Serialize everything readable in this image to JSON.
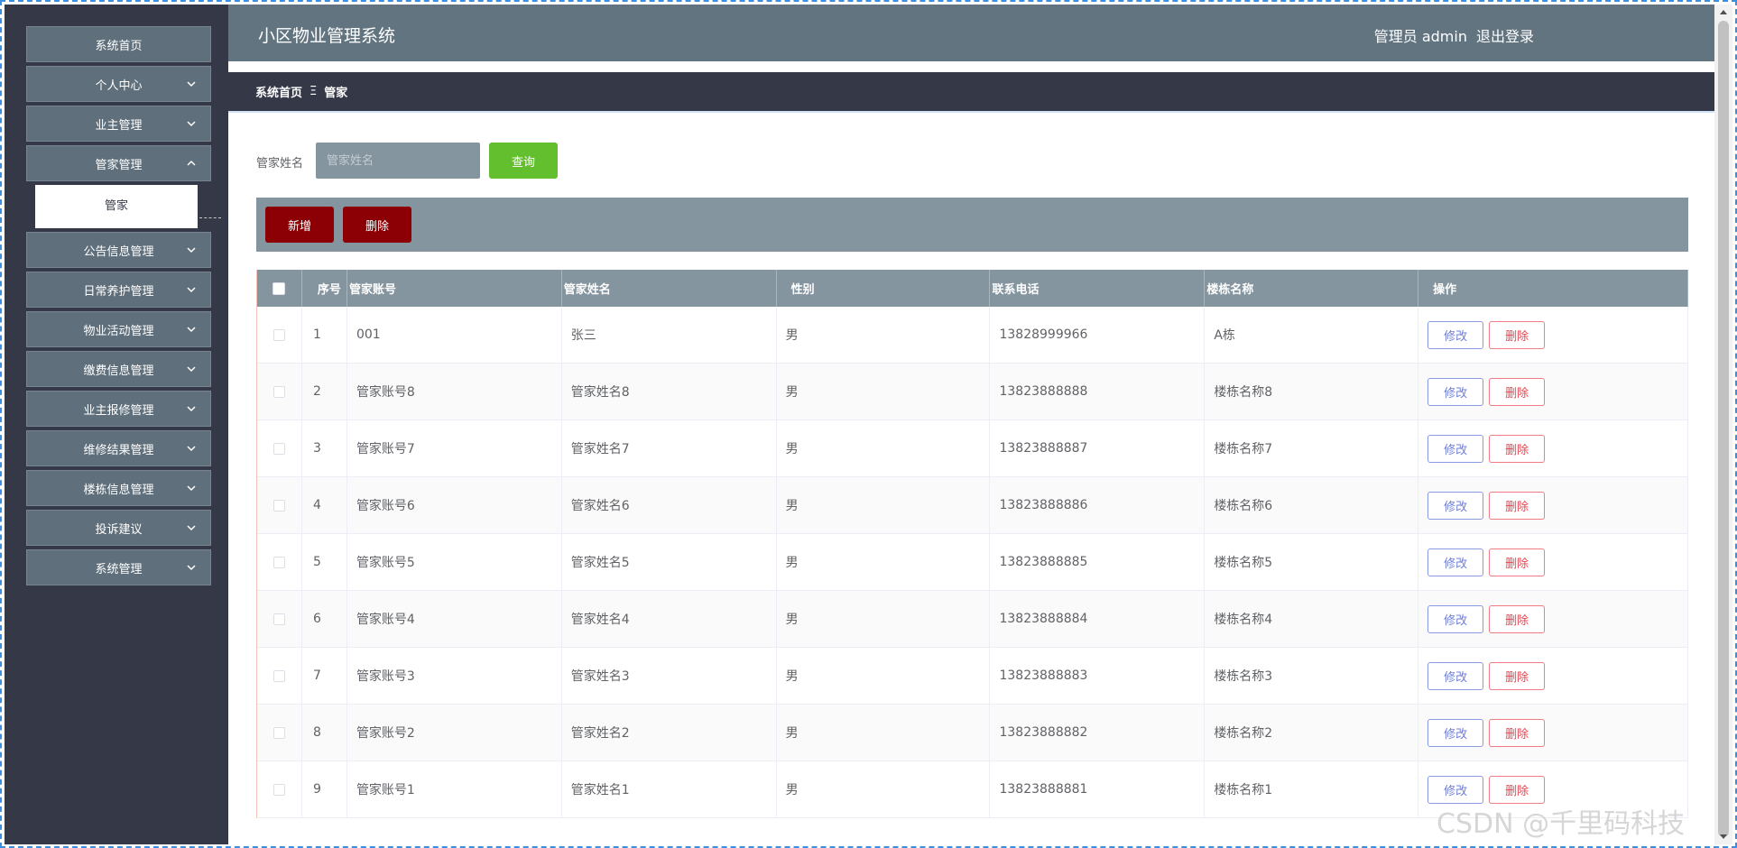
{
  "app": {
    "title": "小区物业管理系统"
  },
  "header": {
    "user": "管理员 admin",
    "logout": "退出登录"
  },
  "sidebar": {
    "items": [
      {
        "label": "系统首页",
        "chevron": "none"
      },
      {
        "label": "个人中心",
        "chevron": "down"
      },
      {
        "label": "业主管理",
        "chevron": "down"
      },
      {
        "label": "管家管理",
        "chevron": "up"
      },
      {
        "label": "公告信息管理",
        "chevron": "down"
      },
      {
        "label": "日常养护管理",
        "chevron": "down"
      },
      {
        "label": "物业活动管理",
        "chevron": "down"
      },
      {
        "label": "缴费信息管理",
        "chevron": "down"
      },
      {
        "label": "业主报修管理",
        "chevron": "down"
      },
      {
        "label": "维修结果管理",
        "chevron": "down"
      },
      {
        "label": "楼栋信息管理",
        "chevron": "down"
      },
      {
        "label": "投诉建议",
        "chevron": "down"
      },
      {
        "label": "系统管理",
        "chevron": "down"
      }
    ],
    "submenu": {
      "label": "管家"
    }
  },
  "breadcrumb": {
    "home": "系统首页",
    "separator": "Ξ",
    "current": "管家"
  },
  "search": {
    "label": "管家姓名",
    "placeholder": "管家姓名",
    "value": "",
    "button": "查询"
  },
  "actions": {
    "add": "新增",
    "delete": "删除"
  },
  "table": {
    "headers": {
      "no": "序号",
      "account": "管家账号",
      "name": "管家姓名",
      "sex": "性别",
      "phone": "联系电话",
      "building": "楼栋名称",
      "op": "操作"
    },
    "edit_label": "修改",
    "delete_label": "删除",
    "rows": [
      {
        "no": "1",
        "account": "001",
        "name": "张三",
        "sex": "男",
        "phone": "13828999966",
        "building": "A栋"
      },
      {
        "no": "2",
        "account": "管家账号8",
        "name": "管家姓名8",
        "sex": "男",
        "phone": "13823888888",
        "building": "楼栋名称8"
      },
      {
        "no": "3",
        "account": "管家账号7",
        "name": "管家姓名7",
        "sex": "男",
        "phone": "13823888887",
        "building": "楼栋名称7"
      },
      {
        "no": "4",
        "account": "管家账号6",
        "name": "管家姓名6",
        "sex": "男",
        "phone": "13823888886",
        "building": "楼栋名称6"
      },
      {
        "no": "5",
        "account": "管家账号5",
        "name": "管家姓名5",
        "sex": "男",
        "phone": "13823888885",
        "building": "楼栋名称5"
      },
      {
        "no": "6",
        "account": "管家账号4",
        "name": "管家姓名4",
        "sex": "男",
        "phone": "13823888884",
        "building": "楼栋名称4"
      },
      {
        "no": "7",
        "account": "管家账号3",
        "name": "管家姓名3",
        "sex": "男",
        "phone": "13823888883",
        "building": "楼栋名称3"
      },
      {
        "no": "8",
        "account": "管家账号2",
        "name": "管家姓名2",
        "sex": "男",
        "phone": "13823888882",
        "building": "楼栋名称2"
      },
      {
        "no": "9",
        "account": "管家账号1",
        "name": "管家姓名1",
        "sex": "男",
        "phone": "13823888881",
        "building": "楼栋名称1"
      }
    ]
  },
  "watermark": "CSDN @千里码科技",
  "colors": {
    "sidebar": "#343847",
    "header": "#627480",
    "accent_green": "#64bf2e",
    "accent_red": "#8c0005",
    "table_header": "#85959f"
  }
}
